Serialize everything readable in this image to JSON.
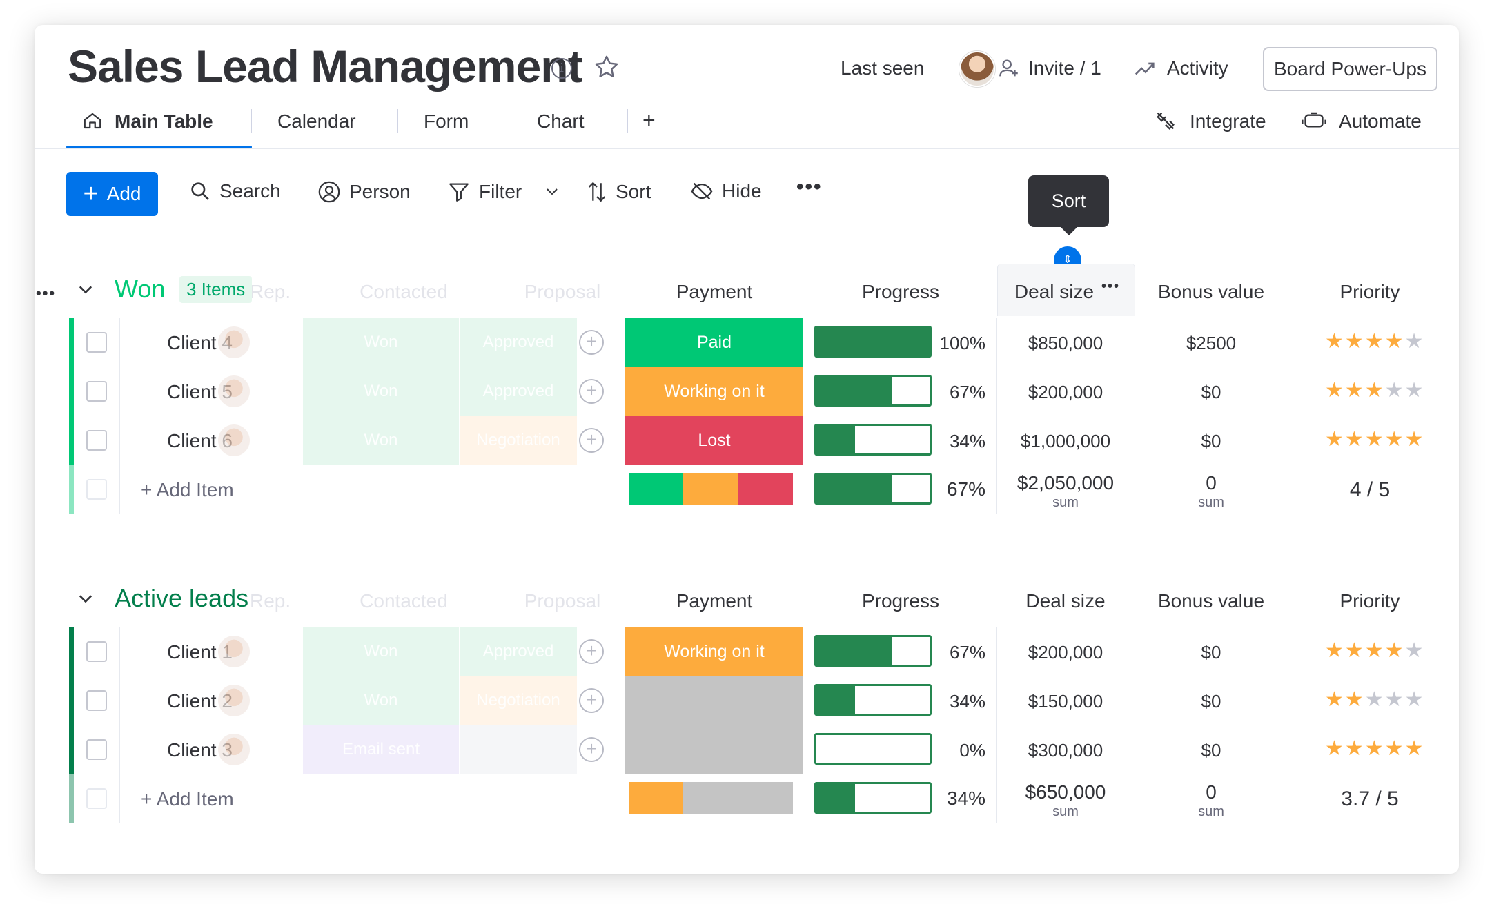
{
  "header": {
    "title": "Sales Lead Management",
    "last_seen_label": "Last seen",
    "invite_label": "Invite / 1",
    "activity_label": "Activity",
    "power_ups_label": "Board Power-Ups"
  },
  "tabs": [
    {
      "label": "Main Table",
      "active": true
    },
    {
      "label": "Calendar"
    },
    {
      "label": "Form"
    },
    {
      "label": "Chart"
    },
    {
      "label": "+"
    }
  ],
  "integrations": {
    "integrate_label": "Integrate",
    "automate_label": "Automate"
  },
  "toolbar": {
    "add_label": "Add",
    "search_label": "Search",
    "person_label": "Person",
    "filter_label": "Filter",
    "sort_label": "Sort",
    "hide_label": "Hide",
    "more_label": "•••"
  },
  "tooltip": {
    "text": "Sort"
  },
  "columns": {
    "rep": "Rep.",
    "contacted": "Contacted",
    "proposal": "Proposal",
    "payment": "Payment",
    "progress": "Progress",
    "deal_size": "Deal size",
    "bonus_value": "Bonus value",
    "priority": "Priority"
  },
  "colors": {
    "won_green": "#00c875",
    "dark_green": "#037f4c",
    "working_orange": "#fdab3d",
    "lost_red": "#e2445c",
    "empty_gray": "#c4c4c4",
    "progress_green": "#258750",
    "accent_blue": "#0073ea"
  },
  "groups": [
    {
      "title": "Won",
      "count_badge": "3 Items",
      "rows": [
        {
          "name": "Client 4",
          "contacted": "Won",
          "proposal": "Approved",
          "payment": "Paid",
          "payment_color": "#00c875",
          "progress": 1.0,
          "progress_label": "100%",
          "deal_size": "$850,000",
          "bonus": "$2500",
          "priority": 4
        },
        {
          "name": "Client 5",
          "contacted": "Won",
          "proposal": "Approved",
          "payment": "Working on it",
          "payment_color": "#fdab3d",
          "progress": 0.67,
          "progress_label": "67%",
          "deal_size": "$200,000",
          "bonus": "$0",
          "priority": 3
        },
        {
          "name": "Client 6",
          "contacted": "Won",
          "proposal": "Negotiation",
          "payment": "Lost",
          "payment_color": "#e2445c",
          "progress": 0.34,
          "progress_label": "34%",
          "deal_size": "$1,000,000",
          "bonus": "$0",
          "priority": 5
        }
      ],
      "summary": {
        "add_item_label": "+ Add Item",
        "payment_split": [
          {
            "color": "#00c875",
            "fraction": 0.333
          },
          {
            "color": "#fdab3d",
            "fraction": 0.333
          },
          {
            "color": "#e2445c",
            "fraction": 0.334
          }
        ],
        "progress": 0.67,
        "progress_label": "67%",
        "deal_size_sum": "$2,050,000",
        "deal_size_caption": "sum",
        "bonus_sum": "0",
        "bonus_caption": "sum",
        "priority_avg": "4 / 5"
      }
    },
    {
      "title": "Active leads",
      "rows": [
        {
          "name": "Client 1",
          "contacted": "Won",
          "proposal": "Approved",
          "payment": "Working on it",
          "payment_color": "#fdab3d",
          "progress": 0.67,
          "progress_label": "67%",
          "deal_size": "$200,000",
          "bonus": "$0",
          "priority": 4
        },
        {
          "name": "Client 2",
          "contacted": "Won",
          "proposal": "Negotiation",
          "payment": "",
          "payment_color": "#c4c4c4",
          "progress": 0.34,
          "progress_label": "34%",
          "deal_size": "$150,000",
          "bonus": "$0",
          "priority": 2
        },
        {
          "name": "Client 3",
          "contacted": "Email sent",
          "proposal": "",
          "payment": "",
          "payment_color": "#c4c4c4",
          "progress": 0.0,
          "progress_label": "0%",
          "deal_size": "$300,000",
          "bonus": "$0",
          "priority": 5
        }
      ],
      "summary": {
        "add_item_label": "+ Add Item",
        "payment_split": [
          {
            "color": "#fdab3d",
            "fraction": 0.333
          },
          {
            "color": "#c4c4c4",
            "fraction": 0.667
          }
        ],
        "progress": 0.34,
        "progress_label": "34%",
        "deal_size_sum": "$650,000",
        "deal_size_caption": "sum",
        "bonus_sum": "0",
        "bonus_caption": "sum",
        "priority_avg": "3.7 / 5"
      }
    }
  ]
}
